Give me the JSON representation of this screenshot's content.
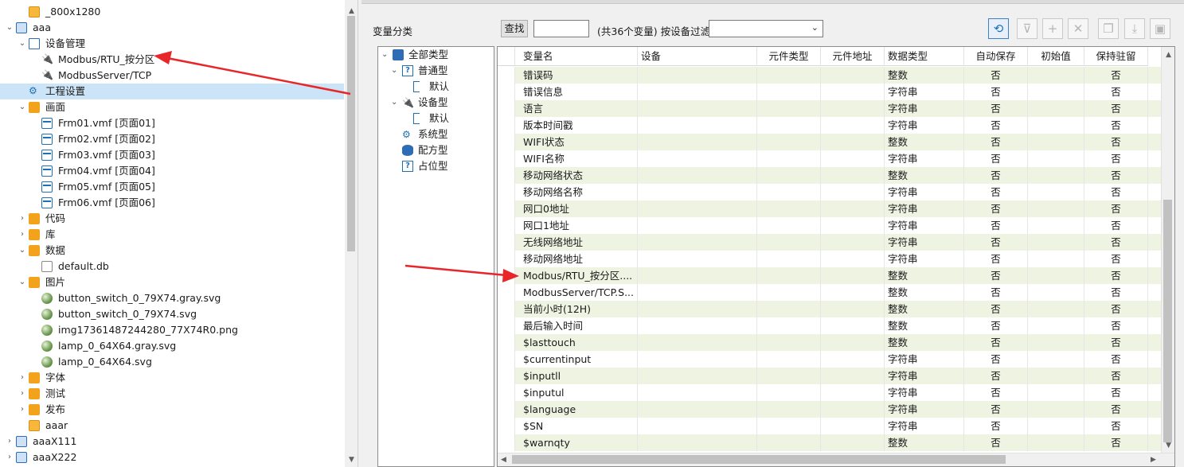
{
  "tree": {
    "items": [
      {
        "label": "_800x1280",
        "icon": "folder-icon"
      },
      {
        "label": "aaa",
        "icon": "project-icon"
      },
      {
        "label": "设备管理",
        "icon": "device-icon"
      },
      {
        "label": "Modbus/RTU_按分区",
        "icon": "plug-icon"
      },
      {
        "label": "ModbusServer/TCP",
        "icon": "plug-icon"
      },
      {
        "label": "工程设置",
        "icon": "gear-icon"
      },
      {
        "label": "画面",
        "icon": "screen-folder-icon"
      },
      {
        "label": "Frm01.vmf [页面01]",
        "icon": "form-icon"
      },
      {
        "label": "Frm02.vmf [页面02]",
        "icon": "form-icon"
      },
      {
        "label": "Frm03.vmf [页面03]",
        "icon": "form-icon"
      },
      {
        "label": "Frm04.vmf [页面04]",
        "icon": "form-icon"
      },
      {
        "label": "Frm05.vmf [页面05]",
        "icon": "form-icon"
      },
      {
        "label": "Frm06.vmf [页面06]",
        "icon": "form-icon"
      },
      {
        "label": "代码",
        "icon": "folder-icon"
      },
      {
        "label": "库",
        "icon": "folder-icon"
      },
      {
        "label": "数据",
        "icon": "folder-icon"
      },
      {
        "label": "default.db",
        "icon": "file-icon"
      },
      {
        "label": "图片",
        "icon": "folder-icon"
      },
      {
        "label": "button_switch_0_79X74.gray.svg",
        "icon": "image-icon"
      },
      {
        "label": "button_switch_0_79X74.svg",
        "icon": "image-icon"
      },
      {
        "label": "img17361487244280_77X74R0.png",
        "icon": "image-icon"
      },
      {
        "label": "lamp_0_64X64.gray.svg",
        "icon": "image-icon"
      },
      {
        "label": "lamp_0_64X64.svg",
        "icon": "image-icon"
      },
      {
        "label": "字体",
        "icon": "folder-icon"
      },
      {
        "label": "测试",
        "icon": "folder-icon"
      },
      {
        "label": "发布",
        "icon": "folder-icon"
      },
      {
        "label": "aaar",
        "icon": "folder-icon"
      },
      {
        "label": "aaaX111",
        "icon": "project-icon"
      },
      {
        "label": "aaaX222",
        "icon": "project-icon"
      }
    ]
  },
  "toolbar": {
    "category_label": "变量分类",
    "find_label": "查找",
    "find_value": "",
    "count_text": "(共36个变量) 按设备过滤",
    "filter_value": ""
  },
  "categories": [
    {
      "label": "全部类型"
    },
    {
      "label": "普通型"
    },
    {
      "label": "默认"
    },
    {
      "label": "设备型"
    },
    {
      "label": "默认"
    },
    {
      "label": "系统型"
    },
    {
      "label": "配方型"
    },
    {
      "label": "占位型"
    }
  ],
  "grid": {
    "columns": [
      "变量名",
      "设备",
      "元件类型",
      "元件地址",
      "数据类型",
      "自动保存",
      "初始值",
      "保持驻留"
    ],
    "rows": [
      {
        "name": "错误码",
        "device": "",
        "type": "",
        "addr": "",
        "dtype": "整数",
        "autosave": "否",
        "init": "",
        "keep": "否"
      },
      {
        "name": "错误信息",
        "device": "",
        "type": "",
        "addr": "",
        "dtype": "字符串",
        "autosave": "否",
        "init": "",
        "keep": "否"
      },
      {
        "name": "语言",
        "device": "",
        "type": "",
        "addr": "",
        "dtype": "字符串",
        "autosave": "否",
        "init": "",
        "keep": "否"
      },
      {
        "name": "版本时间戳",
        "device": "",
        "type": "",
        "addr": "",
        "dtype": "字符串",
        "autosave": "否",
        "init": "",
        "keep": "否"
      },
      {
        "name": "WIFI状态",
        "device": "",
        "type": "",
        "addr": "",
        "dtype": "整数",
        "autosave": "否",
        "init": "",
        "keep": "否"
      },
      {
        "name": "WIFI名称",
        "device": "",
        "type": "",
        "addr": "",
        "dtype": "字符串",
        "autosave": "否",
        "init": "",
        "keep": "否"
      },
      {
        "name": "移动网络状态",
        "device": "",
        "type": "",
        "addr": "",
        "dtype": "整数",
        "autosave": "否",
        "init": "",
        "keep": "否"
      },
      {
        "name": "移动网络名称",
        "device": "",
        "type": "",
        "addr": "",
        "dtype": "字符串",
        "autosave": "否",
        "init": "",
        "keep": "否"
      },
      {
        "name": "网口0地址",
        "device": "",
        "type": "",
        "addr": "",
        "dtype": "字符串",
        "autosave": "否",
        "init": "",
        "keep": "否"
      },
      {
        "name": "网口1地址",
        "device": "",
        "type": "",
        "addr": "",
        "dtype": "字符串",
        "autosave": "否",
        "init": "",
        "keep": "否"
      },
      {
        "name": "无线网络地址",
        "device": "",
        "type": "",
        "addr": "",
        "dtype": "字符串",
        "autosave": "否",
        "init": "",
        "keep": "否"
      },
      {
        "name": "移动网络地址",
        "device": "",
        "type": "",
        "addr": "",
        "dtype": "字符串",
        "autosave": "否",
        "init": "",
        "keep": "否"
      },
      {
        "name": "Modbus/RTU_按分区....",
        "device": "",
        "type": "",
        "addr": "",
        "dtype": "整数",
        "autosave": "否",
        "init": "",
        "keep": "否"
      },
      {
        "name": "ModbusServer/TCP.S...",
        "device": "",
        "type": "",
        "addr": "",
        "dtype": "整数",
        "autosave": "否",
        "init": "",
        "keep": "否"
      },
      {
        "name": "当前小时(12H)",
        "device": "",
        "type": "",
        "addr": "",
        "dtype": "整数",
        "autosave": "否",
        "init": "",
        "keep": "否"
      },
      {
        "name": "最后输入时间",
        "device": "",
        "type": "",
        "addr": "",
        "dtype": "整数",
        "autosave": "否",
        "init": "",
        "keep": "否"
      },
      {
        "name": "$lasttouch",
        "device": "",
        "type": "",
        "addr": "",
        "dtype": "整数",
        "autosave": "否",
        "init": "",
        "keep": "否"
      },
      {
        "name": "$currentinput",
        "device": "",
        "type": "",
        "addr": "",
        "dtype": "字符串",
        "autosave": "否",
        "init": "",
        "keep": "否"
      },
      {
        "name": "$inputll",
        "device": "",
        "type": "",
        "addr": "",
        "dtype": "字符串",
        "autosave": "否",
        "init": "",
        "keep": "否"
      },
      {
        "name": "$inputul",
        "device": "",
        "type": "",
        "addr": "",
        "dtype": "字符串",
        "autosave": "否",
        "init": "",
        "keep": "否"
      },
      {
        "name": "$language",
        "device": "",
        "type": "",
        "addr": "",
        "dtype": "字符串",
        "autosave": "否",
        "init": "",
        "keep": "否"
      },
      {
        "name": "$SN",
        "device": "",
        "type": "",
        "addr": "",
        "dtype": "字符串",
        "autosave": "否",
        "init": "",
        "keep": "否"
      },
      {
        "name": "$warnqty",
        "device": "",
        "type": "",
        "addr": "",
        "dtype": "整数",
        "autosave": "否",
        "init": "",
        "keep": "否"
      }
    ]
  },
  "colors": {
    "accent": "#1f6fb5",
    "row_alt": "#eef3e2",
    "arrow": "#e8262a"
  }
}
